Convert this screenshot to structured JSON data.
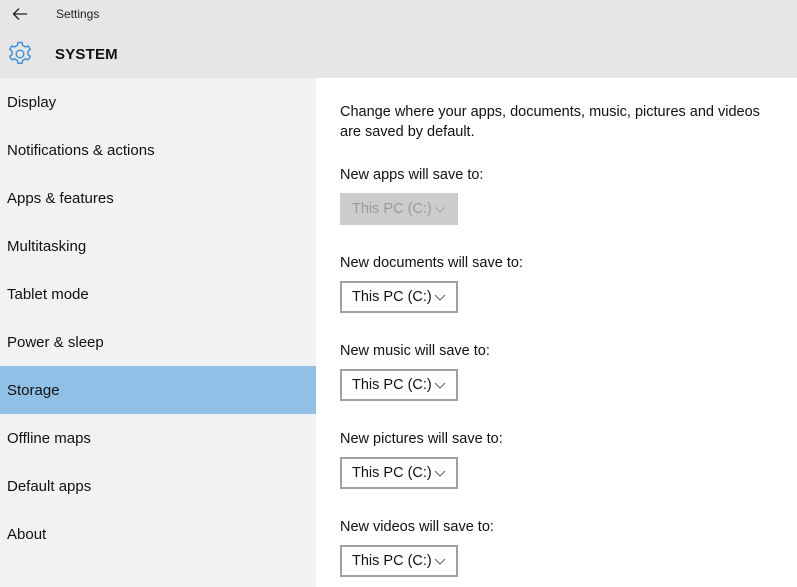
{
  "header": {
    "app_title": "Settings",
    "section_title": "SYSTEM",
    "back_icon": "arrow-left-icon",
    "section_icon": "gear-icon"
  },
  "sidebar": {
    "items": [
      {
        "label": "Display",
        "active": false
      },
      {
        "label": "Notifications & actions",
        "active": false
      },
      {
        "label": "Apps & features",
        "active": false
      },
      {
        "label": "Multitasking",
        "active": false
      },
      {
        "label": "Tablet mode",
        "active": false
      },
      {
        "label": "Power & sleep",
        "active": false
      },
      {
        "label": "Storage",
        "active": true
      },
      {
        "label": "Offline maps",
        "active": false
      },
      {
        "label": "Default apps",
        "active": false
      },
      {
        "label": "About",
        "active": false
      }
    ]
  },
  "main": {
    "description": "Change where your apps, documents, music, pictures and videos are saved by default.",
    "save_locations": [
      {
        "label": "New apps will save to:",
        "value": "This PC (C:)",
        "disabled": true
      },
      {
        "label": "New documents will save to:",
        "value": "This PC (C:)",
        "disabled": false
      },
      {
        "label": "New music will save to:",
        "value": "This PC (C:)",
        "disabled": false
      },
      {
        "label": "New pictures will save to:",
        "value": "This PC (C:)",
        "disabled": false
      },
      {
        "label": "New videos will save to:",
        "value": "This PC (C:)",
        "disabled": false
      }
    ]
  },
  "colors": {
    "accent": "#90c0e6",
    "gear": "#3a8fd6",
    "header_bg": "#e6e6e6",
    "sidebar_bg": "#f2f2f2"
  }
}
